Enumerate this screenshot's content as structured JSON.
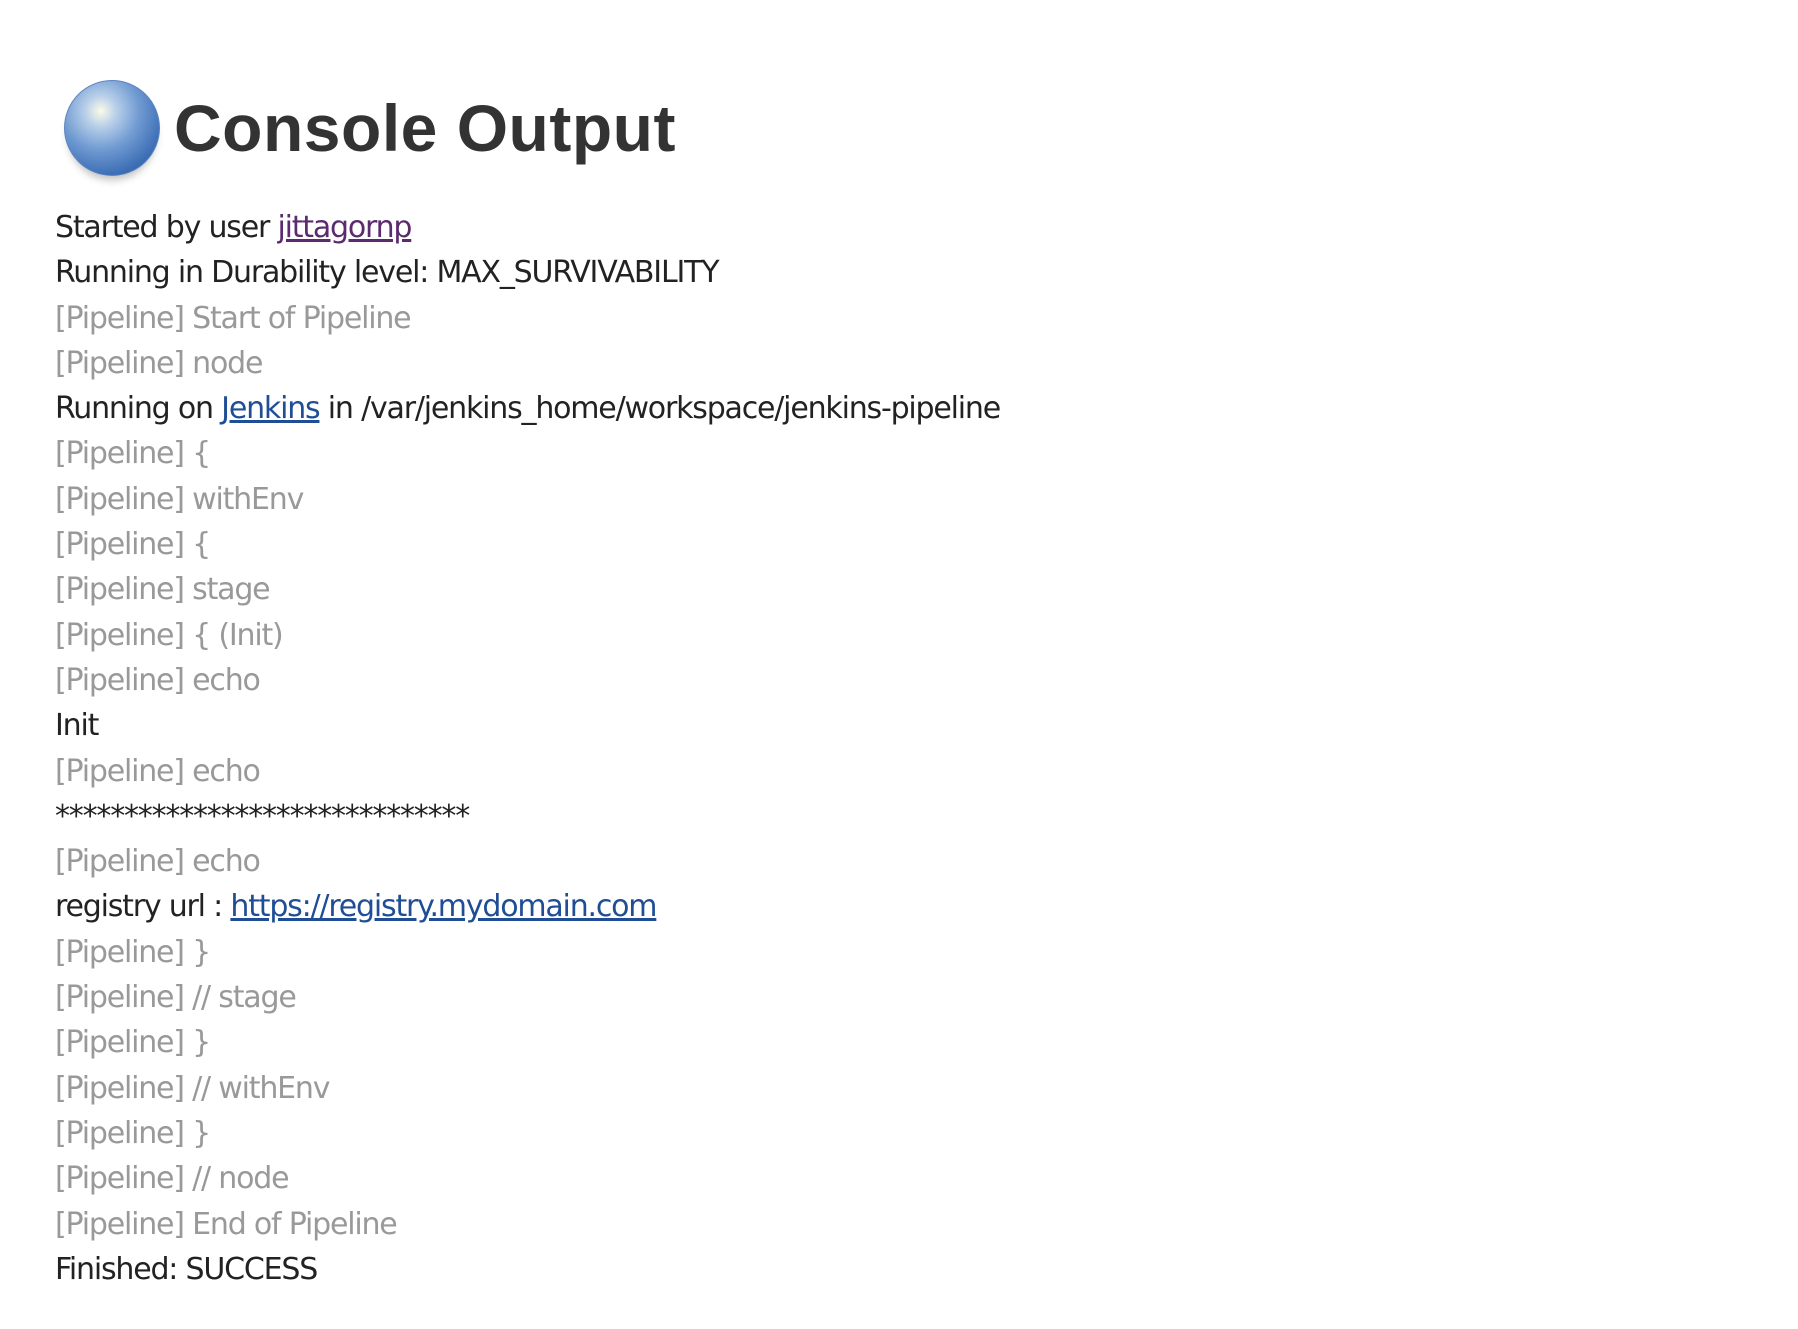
{
  "header": {
    "status_icon": "blue-ball-icon",
    "title": "Console Output"
  },
  "colors": {
    "pipeline_gray": "#999999",
    "text": "#222222",
    "link": "#1f4e96",
    "visited_link": "#5a2c6e"
  },
  "lines": [
    {
      "type": "text",
      "segments": [
        {
          "text": "Started by user "
        },
        {
          "text": "jittagornp",
          "link": "visited"
        }
      ]
    },
    {
      "type": "text",
      "segments": [
        {
          "text": "Running in Durability level: MAX_SURVIVABILITY"
        }
      ]
    },
    {
      "type": "pipeline",
      "segments": [
        {
          "text": "[Pipeline] Start of Pipeline"
        }
      ]
    },
    {
      "type": "pipeline",
      "segments": [
        {
          "text": "[Pipeline] node"
        }
      ]
    },
    {
      "type": "text",
      "segments": [
        {
          "text": "Running on "
        },
        {
          "text": "Jenkins",
          "link": "link"
        },
        {
          "text": " in /var/jenkins_home/workspace/jenkins-pipeline"
        }
      ]
    },
    {
      "type": "pipeline",
      "segments": [
        {
          "text": "[Pipeline] {"
        }
      ]
    },
    {
      "type": "pipeline",
      "segments": [
        {
          "text": "[Pipeline] withEnv"
        }
      ]
    },
    {
      "type": "pipeline",
      "segments": [
        {
          "text": "[Pipeline] {"
        }
      ]
    },
    {
      "type": "pipeline",
      "segments": [
        {
          "text": "[Pipeline] stage"
        }
      ]
    },
    {
      "type": "pipeline",
      "segments": [
        {
          "text": "[Pipeline] { (Init)"
        }
      ]
    },
    {
      "type": "pipeline",
      "segments": [
        {
          "text": "[Pipeline] echo"
        }
      ]
    },
    {
      "type": "text",
      "segments": [
        {
          "text": "Init"
        }
      ]
    },
    {
      "type": "pipeline",
      "segments": [
        {
          "text": "[Pipeline] echo"
        }
      ]
    },
    {
      "type": "text",
      "segments": [
        {
          "text": "******************************"
        }
      ]
    },
    {
      "type": "pipeline",
      "segments": [
        {
          "text": "[Pipeline] echo"
        }
      ]
    },
    {
      "type": "text",
      "segments": [
        {
          "text": "registry url : "
        },
        {
          "text": "https://registry.mydomain.com",
          "link": "link"
        }
      ]
    },
    {
      "type": "pipeline",
      "segments": [
        {
          "text": "[Pipeline] }"
        }
      ]
    },
    {
      "type": "pipeline",
      "segments": [
        {
          "text": "[Pipeline] // stage"
        }
      ]
    },
    {
      "type": "pipeline",
      "segments": [
        {
          "text": "[Pipeline] }"
        }
      ]
    },
    {
      "type": "pipeline",
      "segments": [
        {
          "text": "[Pipeline] // withEnv"
        }
      ]
    },
    {
      "type": "pipeline",
      "segments": [
        {
          "text": "[Pipeline] }"
        }
      ]
    },
    {
      "type": "pipeline",
      "segments": [
        {
          "text": "[Pipeline] // node"
        }
      ]
    },
    {
      "type": "pipeline",
      "segments": [
        {
          "text": "[Pipeline] End of Pipeline"
        }
      ]
    },
    {
      "type": "text",
      "segments": [
        {
          "text": "Finished: SUCCESS"
        }
      ]
    }
  ]
}
